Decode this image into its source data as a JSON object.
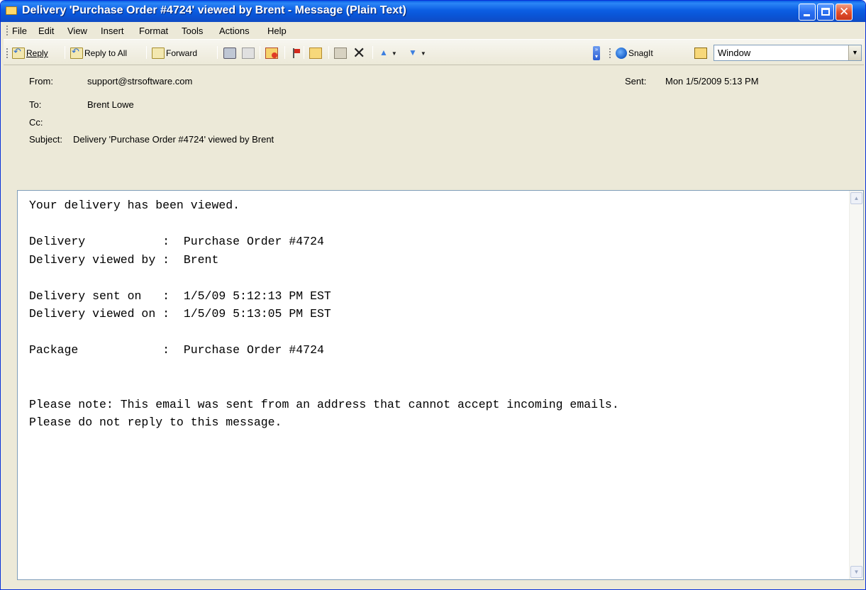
{
  "window": {
    "title": "Delivery 'Purchase Order #4724' viewed by Brent - Message (Plain Text)"
  },
  "menu": [
    {
      "key": "file",
      "label": "File"
    },
    {
      "key": "edit",
      "label": "Edit"
    },
    {
      "key": "view",
      "label": "View"
    },
    {
      "key": "insert",
      "label": "Insert"
    },
    {
      "key": "format",
      "label": "Format"
    },
    {
      "key": "tools",
      "label": "Tools"
    },
    {
      "key": "actions",
      "label": "Actions"
    },
    {
      "key": "help",
      "label": "Help"
    }
  ],
  "toolbar": {
    "reply": "Reply",
    "reply_all": "Reply to All",
    "forward": "Forward",
    "snagit": "SnagIt",
    "capture_mode": "Window"
  },
  "header": {
    "from_label": "From:",
    "from_value": "support@strsoftware.com",
    "sent_label": "Sent:",
    "sent_value": "Mon 1/5/2009 5:13 PM",
    "to_label": "To:",
    "to_value": "Brent Lowe",
    "cc_label": "Cc:",
    "cc_value": "",
    "subject_label": "Subject:",
    "subject_value": "Delivery 'Purchase Order #4724' viewed by Brent"
  },
  "message": {
    "body": "Your delivery has been viewed.\n\nDelivery           :  Purchase Order #4724\nDelivery viewed by :  Brent\n\nDelivery sent on   :  1/5/09 5:12:13 PM EST\nDelivery viewed on :  1/5/09 5:13:05 PM EST\n\nPackage            :  Purchase Order #4724\n\n\nPlease note: This email was sent from an address that cannot accept incoming emails.\nPlease do not reply to this message."
  }
}
